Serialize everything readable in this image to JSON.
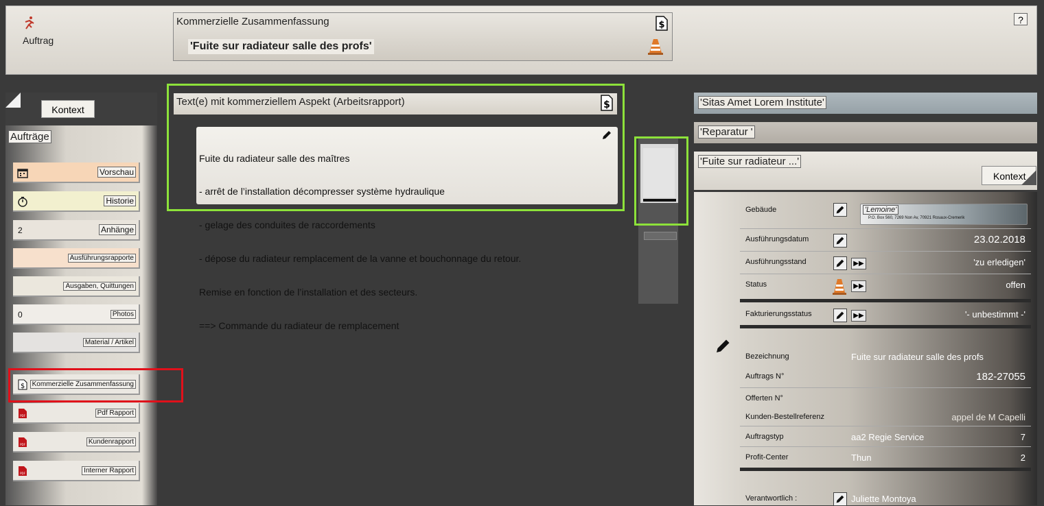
{
  "header": {
    "app_label": "Auftrag",
    "help_label": "?",
    "summary_title": "Kommerzielle Zusammenfassung",
    "summary_name": "'Fuite sur radiateur salle des profs'"
  },
  "sidebar": {
    "kontext": "Kontext",
    "section": "Aufträge",
    "items": [
      {
        "label": "Vorschau",
        "icon": "calendar-icon",
        "bg": "#f7d6b7"
      },
      {
        "label": "Historie",
        "icon": "stopwatch-icon",
        "bg": "#f2f0cf"
      },
      {
        "count": "2",
        "label": "Anhänge",
        "bg": "#e9e4dc"
      },
      {
        "label": "Ausführungsrapporte",
        "bg": "#f7e0cc"
      },
      {
        "label": "Ausgaben, Quittungen",
        "bg": "#ebe7dd"
      },
      {
        "count": "0",
        "label": "Photos",
        "bg": "#f0ede8"
      },
      {
        "label": "Material / Artikel",
        "bg": "#e4e2e0"
      },
      {
        "label": "Kommerzielle Zusammenfassung",
        "icon": "dollar-document-icon",
        "bg": "#ebe8e2"
      },
      {
        "label": "Pdf Rapport",
        "icon": "pdf-icon",
        "bg": "#ebe8e2"
      },
      {
        "label": "Kundenrapport",
        "icon": "pdf-icon",
        "bg": "#ebe8e2"
      },
      {
        "label": "Interner Rapport",
        "icon": "pdf-icon",
        "bg": "#ebe8e2"
      }
    ]
  },
  "center": {
    "title": "Text(e) mit kommerziellem Aspekt (Arbeitsrapport)",
    "lines": [
      "Fuite du radiateur salle des maîtres",
      "- arrêt de l’installation décompresser système hydraulique",
      "- gelage des conduites de raccordements",
      "- dépose du radiateur remplacement de la vanne et bouchonnage du retour.",
      "Remise en fonction de l’installation et des secteurs.",
      "==> Commande du radiateur de remplacement"
    ]
  },
  "right": {
    "client": "'Sitas Amet Lorem Institute'",
    "type": "'Reparatur '",
    "order": "'Fuite sur radiateur ...'",
    "kontext": "Kontext",
    "building_name": "'Lemoine'",
    "building_address": "P.O. Box 560, 7269 Non Av, 70921 Rosaux-Cremerik",
    "rows": {
      "gebaeude": {
        "label": "Gebäude"
      },
      "ausfuehrungsdatum": {
        "label": "Ausführungsdatum",
        "value": "23.02.2018"
      },
      "ausfuehrungsstand": {
        "label": "Ausführungsstand",
        "value": "'zu erledigen'"
      },
      "status": {
        "label": "Status",
        "value": "offen"
      },
      "fakturierungsstatus": {
        "label": "Fakturierungsstatus",
        "value": "'- unbestimmt -'"
      },
      "bezeichnung": {
        "label": "Bezeichnung",
        "value": "Fuite sur radiateur salle des profs"
      },
      "auftrags_nr": {
        "label": "Auftrags N°",
        "value": "182-27055"
      },
      "offerten_nr": {
        "label": "Offerten N°",
        "value": ""
      },
      "kunden_ref": {
        "label": "Kunden-Bestellreferenz",
        "value": "appel de M Capelli"
      },
      "auftragstyp": {
        "label": "Auftragstyp",
        "value": "aa2 Regie Service",
        "num": "7"
      },
      "profit_center": {
        "label": "Profit-Center",
        "value": "Thun",
        "num": "2"
      },
      "verantwortlich": {
        "label": "Verantwortlich :",
        "value": "Juliette Montoya"
      }
    }
  }
}
